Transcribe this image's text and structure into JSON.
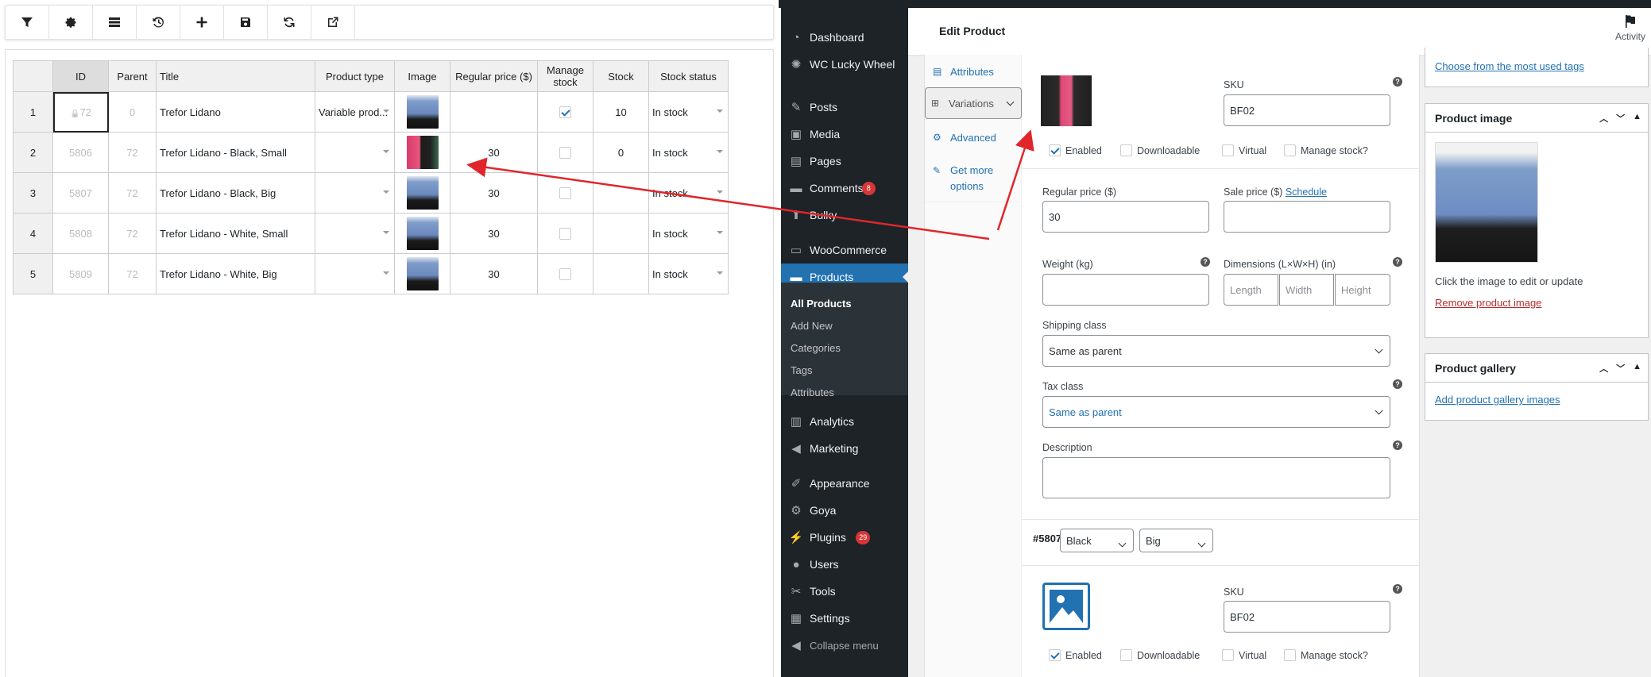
{
  "toolbar": {
    "buttons": [
      "filter-icon",
      "gear-icon",
      "columns-icon",
      "history-icon",
      "plus-icon",
      "save-icon",
      "refresh-icon",
      "external-link-icon"
    ]
  },
  "grid": {
    "headers": [
      "ID",
      "Parent",
      "Title",
      "Product type",
      "Image",
      "Regular price ($)",
      "Manage stock",
      "Stock",
      "Stock status"
    ],
    "rows": [
      {
        "num": "1",
        "id": "72",
        "parent": "0",
        "title": "Trefor Lidano",
        "type": "Variable prod...",
        "image": "blue",
        "price": "",
        "manage": true,
        "stock": "10",
        "status": "In stock"
      },
      {
        "num": "2",
        "id": "5806",
        "parent": "72",
        "title": "Trefor Lidano - Black, Small",
        "type": "",
        "image": "pink",
        "price": "30",
        "manage": false,
        "stock": "0",
        "status": "In stock"
      },
      {
        "num": "3",
        "id": "5807",
        "parent": "72",
        "title": "Trefor Lidano - Black, Big",
        "type": "",
        "image": "blue",
        "price": "30",
        "manage": false,
        "stock": "",
        "status": "In stock"
      },
      {
        "num": "4",
        "id": "5808",
        "parent": "72",
        "title": "Trefor Lidano - White, Small",
        "type": "",
        "image": "blue",
        "price": "30",
        "manage": false,
        "stock": "",
        "status": "In stock"
      },
      {
        "num": "5",
        "id": "5809",
        "parent": "72",
        "title": "Trefor Lidano - White, Big",
        "type": "",
        "image": "blue",
        "price": "30",
        "manage": false,
        "stock": "",
        "status": "In stock"
      }
    ]
  },
  "sidebar": {
    "items": [
      {
        "label": "Dashboard",
        "icon": "dashboard-icon"
      },
      {
        "label": "WC Lucky Wheel",
        "icon": "wheel-icon"
      },
      {
        "label": "Posts",
        "icon": "pin-icon"
      },
      {
        "label": "Media",
        "icon": "media-icon"
      },
      {
        "label": "Pages",
        "icon": "pages-icon"
      },
      {
        "label": "Comments",
        "icon": "comments-icon",
        "badge": "8"
      },
      {
        "label": "Bulky",
        "icon": "bulky-icon"
      },
      {
        "label": "WooCommerce",
        "icon": "woo-icon"
      },
      {
        "label": "Products",
        "icon": "products-icon"
      },
      {
        "label": "Analytics",
        "icon": "analytics-icon"
      },
      {
        "label": "Marketing",
        "icon": "marketing-icon"
      },
      {
        "label": "Appearance",
        "icon": "appearance-icon"
      },
      {
        "label": "Goya",
        "icon": "gear-icon"
      },
      {
        "label": "Plugins",
        "icon": "plugins-icon",
        "badge": "29"
      },
      {
        "label": "Users",
        "icon": "users-icon"
      },
      {
        "label": "Tools",
        "icon": "tools-icon"
      },
      {
        "label": "Settings",
        "icon": "settings-icon"
      },
      {
        "label": "Collapse menu",
        "icon": "collapse-icon"
      }
    ],
    "submenu": [
      "All Products",
      "Add New",
      "Categories",
      "Tags",
      "Attributes"
    ]
  },
  "header": {
    "title": "Edit Product",
    "activity": "Activity"
  },
  "tabs": [
    {
      "label": "Attributes",
      "icon": "attributes-icon"
    },
    {
      "label": "Variations",
      "icon": "variations-icon"
    },
    {
      "label": "Advanced",
      "icon": "advanced-icon"
    },
    {
      "label": "Get more options",
      "icon": "plugin-icon"
    }
  ],
  "variation1": {
    "sku_label": "SKU",
    "sku": "BF02",
    "enabled": "Enabled",
    "downloadable": "Downloadable",
    "virtual": "Virtual",
    "manage_stock": "Manage stock?",
    "regular_label": "Regular price ($)",
    "regular": "30",
    "sale_label": "Sale price ($)",
    "schedule": "Schedule",
    "weight_label": "Weight (kg)",
    "dims_label": "Dimensions (L×W×H) (in)",
    "length_ph": "Length",
    "width_ph": "Width",
    "height_ph": "Height",
    "shipping_label": "Shipping class",
    "shipping": "Same as parent",
    "tax_label": "Tax class",
    "tax": "Same as parent",
    "desc_label": "Description"
  },
  "variation2": {
    "id": "#5807",
    "color": "Black",
    "size": "Big",
    "sku_label": "SKU",
    "sku": "BF02",
    "enabled": "Enabled",
    "downloadable": "Downloadable",
    "virtual": "Virtual",
    "manage_stock": "Manage stock?"
  },
  "right": {
    "tags_link": "Choose from the most used tags",
    "product_image_title": "Product image",
    "image_hint": "Click the image to edit or update",
    "remove_image": "Remove product image",
    "gallery_title": "Product gallery",
    "gallery_link": "Add product gallery images"
  },
  "colors": {
    "wp_blue": "#2271b1",
    "sidebar_bg": "#1d2327",
    "arrow": "#e0262b",
    "badge": "#d63638"
  }
}
